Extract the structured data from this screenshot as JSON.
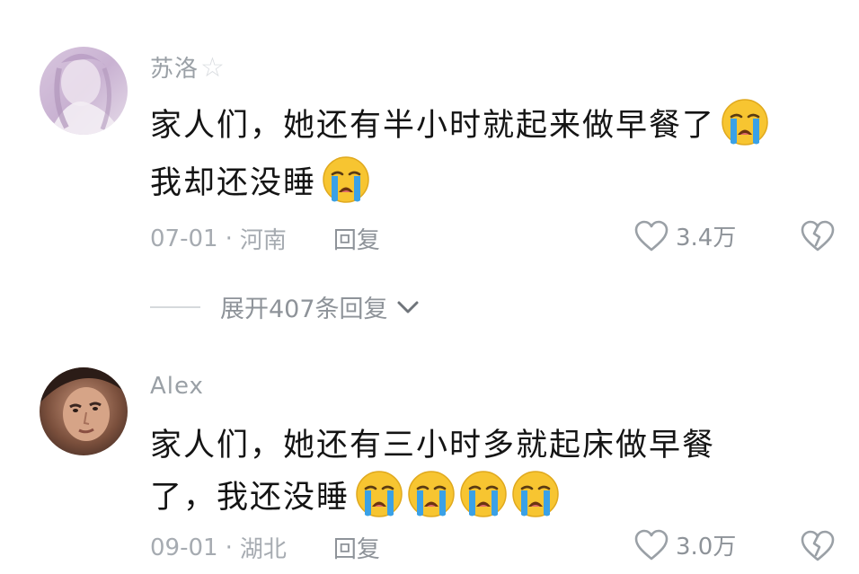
{
  "comments": [
    {
      "username": "苏洛",
      "username_decoration": "☆",
      "avatar_icon": "avatar-pastel-portrait",
      "line1": "家人们，她还有半小时就起来做早餐了",
      "line1_emojis": [
        "crying-face-emoji"
      ],
      "line2": "我却还没睡",
      "line2_emojis": [
        "crying-face-emoji"
      ],
      "date": "07-01",
      "location": "河南",
      "reply_label": "回复",
      "like_count": "3.4万",
      "expand_label": "展开407条回复"
    },
    {
      "username": "Alex",
      "avatar_icon": "avatar-photo-portrait",
      "line1": "家人们，她还有三小时多就起床做早餐",
      "line1_emojis": [],
      "line2": "了，我还没睡",
      "line2_emojis": [
        "crying-face-emoji",
        "crying-face-emoji",
        "crying-face-emoji",
        "crying-face-emoji"
      ],
      "date": "09-01",
      "location": "湖北",
      "reply_label": "回复",
      "like_count": "3.0万"
    }
  ],
  "separator": "·",
  "colors": {
    "meta_text": "#a6abb1",
    "body_text": "#141414",
    "emoji_face": "#f7c531",
    "emoji_tear": "#3aa1e6"
  }
}
